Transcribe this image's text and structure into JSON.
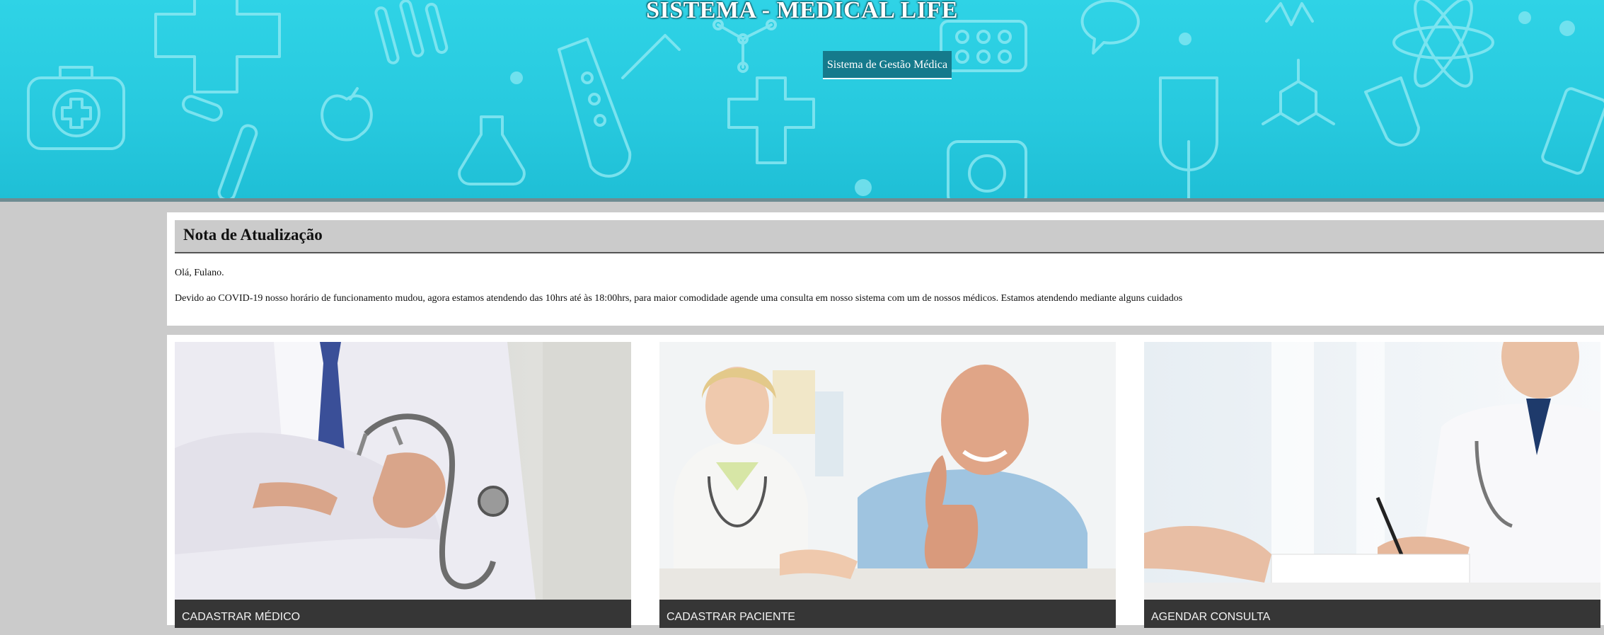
{
  "header": {
    "title": "SISTEMA - MEDICAL LIFE",
    "subtitle_button": "Sistema de Gestão Médica"
  },
  "update_note": {
    "title": "Nota de Atualização",
    "greeting": "Olá, Fulano.",
    "message": "Devido ao COVID-19 nosso horário de funcionamento mudou, agora estamos atendendo das 10hrs até às 18:00hrs, para maior comodidade agende uma consulta em nosso sistema com um de nossos médicos. Estamos atendendo mediante alguns cuidados"
  },
  "cards": [
    {
      "label": "CADASTRAR MÉDICO",
      "image": "doctor-with-stethoscope-photo"
    },
    {
      "label": "CADASTRAR PACIENTE",
      "image": "doctor-and-patient-thumbs-up-photo"
    },
    {
      "label": "AGENDAR CONSULTA",
      "image": "doctor-writing-consultation-photo"
    }
  ],
  "colors": {
    "banner": "#27c9de",
    "subtitle_button": "#157a8c",
    "page_background": "#cbcbcb",
    "caption_bar": "#363636"
  }
}
